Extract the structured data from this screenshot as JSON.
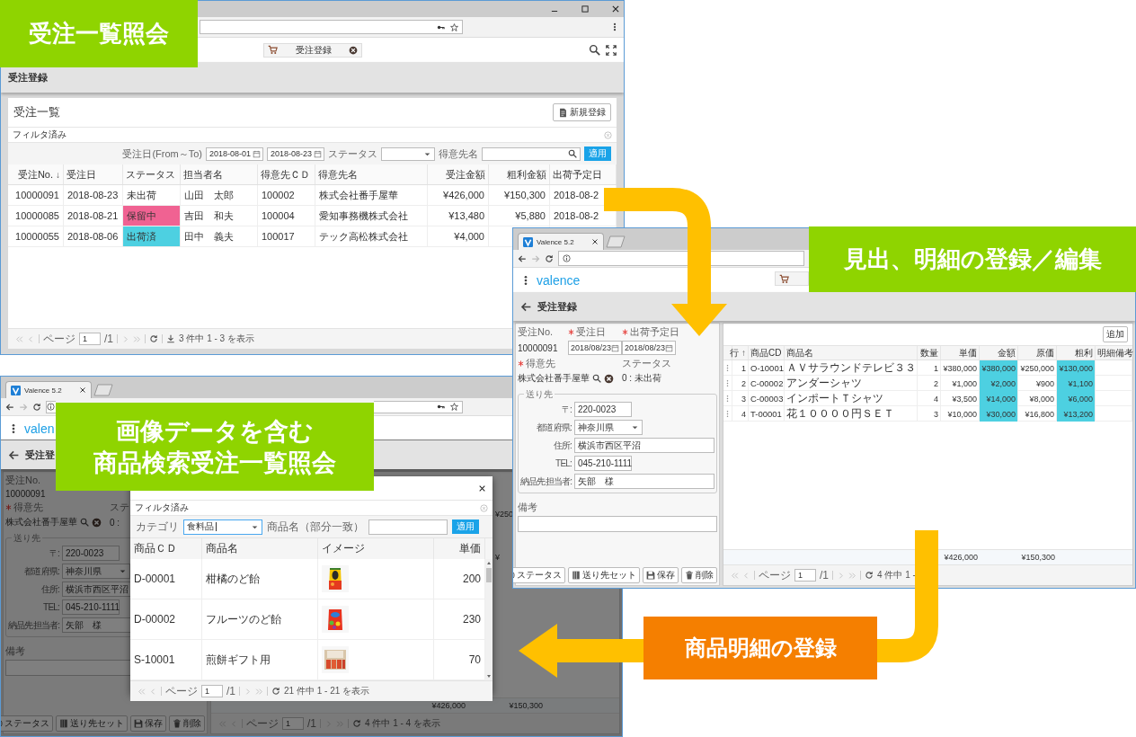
{
  "callouts": [
    {
      "text": "受注一覧照会",
      "color": "#8fd400"
    },
    {
      "text": "見出、明細の登録／編集",
      "color": "#8fd400"
    },
    {
      "lines": [
        "画像データを含む",
        "商品検索受注一覧照会"
      ],
      "color": "#8fd400"
    },
    {
      "text": "商品明細の登録",
      "color": "#f57f00"
    }
  ],
  "order_list_window": {
    "app_tab": "受注登録",
    "page_title": "受注登録",
    "card_title": "受注一覧",
    "new_button": "新規登録",
    "filter_status": "フィルタ済み",
    "filters": {
      "date_label": "受注日(From～To)",
      "date_from": "2018-08-01",
      "date_to": "2018-08-23",
      "status_label": "ステータス",
      "customer_label": "得意先名",
      "apply_button": "適用"
    },
    "columns": [
      {
        "label": "受注No.",
        "kind": "number",
        "sort_mark": "↓"
      },
      {
        "label": "受注日",
        "kind": "text"
      },
      {
        "label": "ステータス",
        "kind": "status"
      },
      {
        "label": "担当者名",
        "kind": "text"
      },
      {
        "label": "得意先ＣＤ",
        "kind": "text"
      },
      {
        "label": "得意先名",
        "kind": "text"
      },
      {
        "label": "受注金額",
        "kind": "number"
      },
      {
        "label": "粗利金額",
        "kind": "number"
      },
      {
        "label": "出荷予定日",
        "kind": "text"
      }
    ],
    "rows": [
      {
        "cells": [
          "10000091",
          "2018-08-23",
          "未出荷",
          "山田　太郎",
          "100002",
          "株式会社番手屋華",
          "¥426,000",
          "¥150,300",
          "2018-08-2"
        ]
      },
      {
        "cells": [
          "10000085",
          "2018-08-21",
          "保留中",
          "吉田　和夫",
          "100004",
          "愛知事務機株式会社",
          "¥13,480",
          "¥5,880",
          "2018-08-2"
        ],
        "color": "#f06292"
      },
      {
        "cells": [
          "10000055",
          "2018-08-06",
          "出荷済",
          "田中　義夫",
          "100017",
          "テック高松株式会社",
          "¥4,000"
        ],
        "color": "#4dd0e1"
      }
    ],
    "pager": {
      "page_label": "ページ",
      "page": "1",
      "total_pages": "/1",
      "summary": "3 件中 1 - 3 を表示"
    }
  },
  "order_entry_window": {
    "browser_tab": "Valence 5.2",
    "logo": "valence",
    "page_title": "受注登録",
    "form": {
      "header_fields": [
        {
          "label": "受注No.",
          "value": "10000091",
          "kind": "text",
          "required": false
        },
        {
          "label": "受注日",
          "value": "2018/08/23",
          "kind": "date",
          "required": true
        },
        {
          "label": "出荷予定日",
          "value": "2018/08/23",
          "kind": "date",
          "required": true
        }
      ],
      "customer": {
        "label": "得意先",
        "required": true,
        "value": "株式会社番手屋華"
      },
      "status": {
        "label": "ステータス",
        "value": "0 : 未出荷"
      },
      "ship_to": {
        "legend": "送り先",
        "fields": [
          {
            "label": "〒:",
            "value": "220-0023",
            "kind": "short"
          },
          {
            "label": "都道府県:",
            "value": "神奈川県",
            "kind": "select"
          },
          {
            "label": "住所:",
            "value": "横浜市西区平沼",
            "kind": "wide"
          },
          {
            "label": "TEL:",
            "value": "045-210-1111",
            "kind": "short"
          },
          {
            "label": "納品先担当者:",
            "value": "矢部　様",
            "kind": "wide"
          }
        ]
      },
      "remarks_label": "備考",
      "buttons": [
        {
          "label": "ステータス"
        },
        {
          "label": "送り先セット"
        },
        {
          "label": "保存"
        },
        {
          "label": "削除"
        }
      ]
    },
    "grid": {
      "add_button": "追加",
      "columns": [
        {
          "label": "行",
          "kind": "number",
          "sort_mark": "↑"
        },
        {
          "label": "商品CD",
          "kind": "text"
        },
        {
          "label": "商品名",
          "kind": "text"
        },
        {
          "label": "数量",
          "kind": "number"
        },
        {
          "label": "単価",
          "kind": "number"
        },
        {
          "label": "金額",
          "kind": "highlight"
        },
        {
          "label": "原価",
          "kind": "number"
        },
        {
          "label": "粗利",
          "kind": "highlight"
        },
        {
          "label": "明細備考",
          "kind": "text"
        }
      ],
      "rows": [
        {
          "cells": [
            "1",
            "O-10001",
            "ＡＶサラウンドテレビ３３",
            "1",
            "¥380,000",
            "¥380,000",
            "¥250,000",
            "¥130,000"
          ]
        },
        {
          "cells": [
            "2",
            "C-00002",
            "アンダーシャツ",
            "2",
            "¥1,000",
            "¥2,000",
            "¥900",
            "¥1,100"
          ]
        },
        {
          "cells": [
            "3",
            "C-00003",
            "インポートＴシャツ",
            "4",
            "¥3,500",
            "¥14,000",
            "¥8,000",
            "¥6,000"
          ]
        },
        {
          "cells": [
            "4",
            "T-00001",
            "花１００００円ＳＥＴ",
            "3",
            "¥10,000",
            "¥30,000",
            "¥16,800",
            "¥13,200"
          ]
        }
      ],
      "totals": {
        "amount": "¥426,000",
        "profit": "¥150,300"
      },
      "pager": {
        "page_label": "ページ",
        "page": "1",
        "total_pages": "/1",
        "summary": "4 件中 1 -"
      }
    }
  },
  "product_search_window": {
    "browser_tab": "Valence 5.2",
    "logo": "valen",
    "page_title": "受注登",
    "form": {
      "header_fields": [
        {
          "label": "受注No.",
          "value": "10000091",
          "kind": "text",
          "required": false
        }
      ],
      "customer": {
        "label": "得意先",
        "required": true,
        "value": "株式会社番手屋華"
      },
      "status": {
        "label": "ステ",
        "value": "0 :"
      },
      "ship_to": {
        "legend": "送り先",
        "fields": [
          {
            "label": "〒:",
            "value": "220-0023",
            "kind": "short"
          },
          {
            "label": "都道府県:",
            "value": "神奈川県",
            "kind": "select"
          },
          {
            "label": "住所:",
            "value": "横浜市西区平沼",
            "kind": "wide"
          },
          {
            "label": "TEL:",
            "value": "045-210-1111",
            "kind": "short"
          },
          {
            "label": "納品先担当者:",
            "value": "矢部　様",
            "kind": "wide"
          }
        ]
      },
      "remarks_label": "備考",
      "buttons": [
        {
          "label": "ステータス"
        },
        {
          "label": "送り先セット"
        },
        {
          "label": "保存"
        },
        {
          "label": "削除"
        }
      ]
    },
    "grid": {
      "cost_fragments": [
        "¥250",
        "¥"
      ],
      "totals": {
        "amount": "¥426,000",
        "profit": "¥150,300"
      },
      "pager": {
        "page_label": "ページ",
        "page": "1",
        "total_pages": "/1",
        "summary": "4 件中 1 - 4 を表示"
      }
    },
    "dialog": {
      "filter_status": "フィルタ済み",
      "category_label": "カテゴリ",
      "category_value": "食料品",
      "category_focused": true,
      "name_label": "商品名（部分一致）",
      "apply_button": "適用",
      "columns": [
        {
          "label": "商品ＣＤ",
          "kind": "text"
        },
        {
          "label": "商品名",
          "kind": "text"
        },
        {
          "label": "イメージ",
          "kind": "picture"
        },
        {
          "label": "単価",
          "kind": "number"
        }
      ],
      "rows": [
        {
          "cells": [
            "D-00001",
            "柑橘のど飴",
            {
              "kind": "picture"
            },
            "200"
          ]
        },
        {
          "cells": [
            "D-00002",
            "フルーツのど飴",
            {
              "kind": "picture"
            },
            "230"
          ]
        },
        {
          "cells": [
            "S-10001",
            "煎餅ギフト用",
            {
              "kind": "picture"
            },
            "70"
          ]
        }
      ],
      "pager": {
        "page_label": "ページ",
        "page": "1",
        "total_pages": "/1",
        "summary": "21 件中 1 - 21 を表示"
      }
    }
  }
}
